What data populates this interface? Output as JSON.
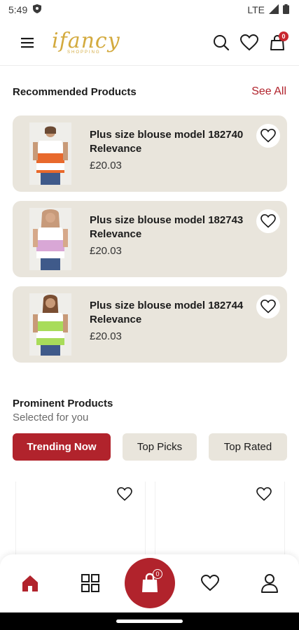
{
  "status_bar": {
    "time": "5:49",
    "network": "LTE"
  },
  "header": {
    "logo_text": "ifancy",
    "logo_subtext": "SHOPPING",
    "cart_count": "0"
  },
  "recommended": {
    "title": "Recommended Products",
    "see_all": "See All",
    "items": [
      {
        "name": "Plus size blouse model 182740 Relevance",
        "price": "£20.03",
        "colors": [
          "#ffffff",
          "#e8692c"
        ]
      },
      {
        "name": "Plus size blouse model 182743 Relevance",
        "price": "£20.03",
        "colors": [
          "#ffffff",
          "#d9a7d6"
        ]
      },
      {
        "name": "Plus size blouse model 182744 Relevance",
        "price": "£20.03",
        "colors": [
          "#ffffff",
          "#a8dc5a"
        ]
      }
    ]
  },
  "prominent": {
    "title": "Prominent Products",
    "subtitle": "Selected for you",
    "tabs": [
      {
        "label": "Trending Now",
        "active": true
      },
      {
        "label": "Top Picks",
        "active": false
      },
      {
        "label": "Top Rated",
        "active": false
      }
    ]
  },
  "bottom_nav": {
    "items": [
      "home-icon",
      "grid-icon",
      "shopping-bag-icon",
      "heart-icon",
      "profile-icon"
    ],
    "bag_count": "0"
  },
  "colors": {
    "accent": "#b1232c",
    "card_bg": "#e9e5dc",
    "logo": "#d3aa3e"
  }
}
